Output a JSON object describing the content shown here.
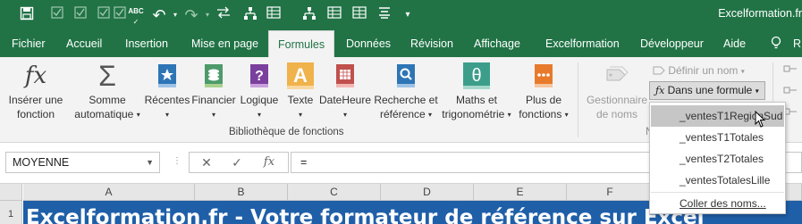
{
  "window": {
    "title": "Excelformation.fr"
  },
  "quick_access": {
    "icons": [
      "save-icon",
      "checkbox-icon",
      "checkbox-icon",
      "checkbox-icon",
      "checkbox-icon",
      "spellcheck-icon",
      "undo-icon",
      "redo-icon",
      "arrows-icon",
      "org-chart-icon",
      "table-icon",
      "org-chart-icon",
      "table-icon",
      "table-icon",
      "align-icon",
      "more-icon"
    ],
    "spellcheck_text": "ABC"
  },
  "tabs": [
    "Fichier",
    "Accueil",
    "Insertion",
    "Mise en page",
    "Formules",
    "Données",
    "Révision",
    "Affichage",
    "Excelformation",
    "Développeur",
    "Aide",
    "R"
  ],
  "active_tab": "Formules",
  "ribbon": {
    "insert_function": {
      "icon_text": "fx",
      "line1": "Insérer une",
      "line2": "fonction"
    },
    "autosum": {
      "icon_text": "Σ",
      "line1": "Somme",
      "line2": "automatique"
    },
    "recent": {
      "label": "Récentes"
    },
    "financial": {
      "label": "Financier"
    },
    "logical": {
      "label": "Logique"
    },
    "text": {
      "icon_text": "A",
      "label": "Texte"
    },
    "datetime": {
      "label": "DateHeure"
    },
    "lookup": {
      "line1": "Recherche et",
      "line2": "référence"
    },
    "math": {
      "icon_text": "θ",
      "line1": "Maths et",
      "line2": "trigonométrie"
    },
    "more": {
      "line1": "Plus de",
      "line2": "fonctions"
    },
    "group_label": "Bibliothèque de fonctions",
    "name_manager": {
      "line1": "Gestionnaire",
      "line2": "de noms"
    },
    "define_name": "Définir un nom",
    "use_in_formula": "Dans une formule",
    "defined_names_group_initial": "N"
  },
  "dropdown_menu": {
    "items": [
      "_ventesT1RegionSud",
      "_ventesT1Totales",
      "_ventesT2Totales",
      "_ventesTotalesLille"
    ],
    "paste_names": "Coller des noms..."
  },
  "formula_bar": {
    "name_box": "MOYENNE",
    "cancel_icon": "✕",
    "enter_icon": "✓",
    "fx_label": "fx",
    "content": "="
  },
  "grid": {
    "columns": [
      "A",
      "B",
      "C",
      "D",
      "E",
      "F"
    ],
    "row_number": "1",
    "banner_text": "Excelformation.fr - Votre formateur de référence sur Excel"
  },
  "colors": {
    "excel_green": "#217346",
    "banner_blue": "#1f5fa8"
  }
}
